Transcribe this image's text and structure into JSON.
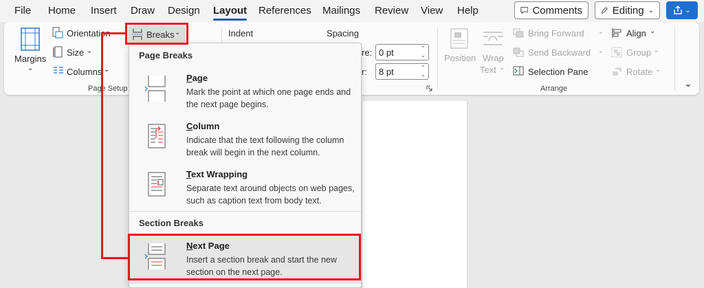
{
  "menu": {
    "tabs": [
      "File",
      "Home",
      "Insert",
      "Draw",
      "Design",
      "Layout",
      "References",
      "Mailings",
      "Review",
      "View",
      "Help"
    ],
    "active": "Layout",
    "comments_label": "Comments",
    "editing_label": "Editing"
  },
  "ribbon": {
    "page_setup": {
      "margins": "Margins",
      "orientation": "Orientation",
      "size": "Size",
      "columns": "Columns",
      "breaks": "Breaks",
      "label": "Page Setup"
    },
    "paragraph": {
      "indent": "Indent",
      "spacing": "Spacing",
      "before_label": "re:",
      "before_value": "0 pt",
      "after_label": "r:",
      "after_value": "8 pt"
    },
    "arrange": {
      "position": "Position",
      "wrap": "Wrap",
      "text": "Text",
      "bring_forward": "Bring Forward",
      "send_backward": "Send Backward",
      "selection_pane": "Selection Pane",
      "align": "Align",
      "group": "Group",
      "rotate": "Rotate",
      "label": "Arrange"
    }
  },
  "breaks_menu": {
    "page_breaks_heading": "Page Breaks",
    "section_breaks_heading": "Section Breaks",
    "items": [
      {
        "title": "Page",
        "desc": "Mark the point at which one page ends and the next page begins."
      },
      {
        "title": "Column",
        "desc": "Indicate that the text following the column break will begin in the next column."
      },
      {
        "title": "Text Wrapping",
        "desc": "Separate text around objects on web pages, such as caption text from body text."
      },
      {
        "title": "Next Page",
        "desc": "Insert a section break and start the new section on the next page."
      }
    ]
  },
  "colors": {
    "highlight": "#e8161e",
    "accent": "#185abd",
    "share": "#1f6fd1"
  }
}
